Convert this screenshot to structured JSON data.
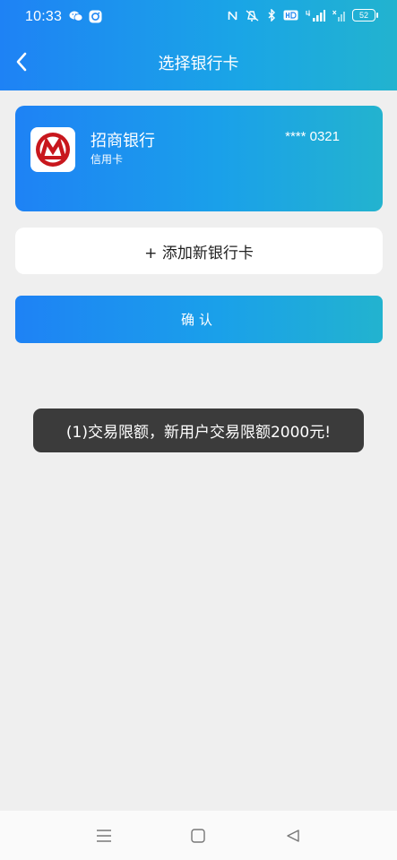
{
  "status_bar": {
    "time": "10:33",
    "battery": "52",
    "icons": [
      "wechat-icon",
      "app-notification-icon",
      "nfc-icon",
      "mute-icon",
      "bluetooth-icon",
      "hd-icon",
      "signal-4g-icon",
      "signal-icon"
    ]
  },
  "header": {
    "title": "选择银行卡",
    "back_icon": "chevron-left-icon"
  },
  "bank_card": {
    "bank_name": "招商银行",
    "card_type": "信用卡",
    "card_number": "**** 0321",
    "logo_icon": "cmb-logo-icon"
  },
  "add_card": {
    "label": "+ 添加新银行卡"
  },
  "confirm": {
    "label": "确认"
  },
  "toast": {
    "message": "(1)交易限额，新用户交易限额2000元!"
  },
  "system_nav": {
    "icons": [
      "menu-icon",
      "home-icon",
      "back-triangle-icon"
    ]
  },
  "colors": {
    "accent_start": "#1e82f5",
    "accent_end": "#22b3cf",
    "background": "#efefef",
    "toast_bg": "#3b3b3b",
    "bank_logo_red": "#c8171d"
  }
}
